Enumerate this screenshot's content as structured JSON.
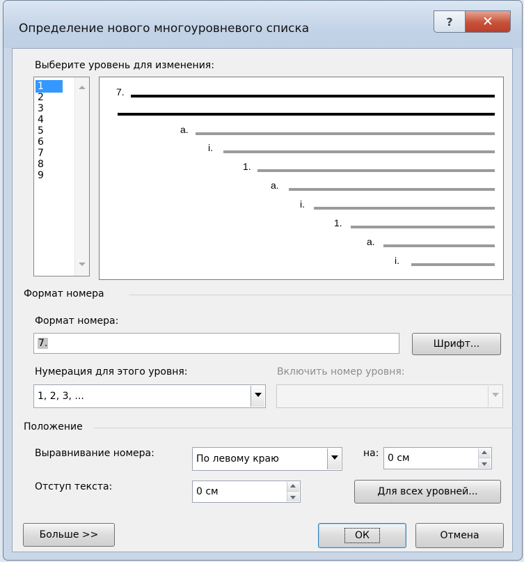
{
  "window": {
    "title": "Определение нового многоуровневого списка",
    "help_glyph": "?",
    "close_glyph": "✕"
  },
  "levels": {
    "label": "Выберите уровень для изменения:",
    "items": [
      "1",
      "2",
      "3",
      "4",
      "5",
      "6",
      "7",
      "8",
      "9"
    ],
    "selected": "1"
  },
  "preview": {
    "rows": [
      {
        "label": "7.",
        "bold": true
      },
      {
        "label": "",
        "bold": true
      },
      {
        "label": "a.",
        "bold": false
      },
      {
        "label": "i.",
        "bold": false
      },
      {
        "label": "1.",
        "bold": false
      },
      {
        "label": "a.",
        "bold": false
      },
      {
        "label": "i.",
        "bold": false
      },
      {
        "label": "1.",
        "bold": false
      },
      {
        "label": "a.",
        "bold": false
      },
      {
        "label": "i.",
        "bold": false
      }
    ]
  },
  "number_format": {
    "section_title": "Формат номера",
    "field_label": "Формат номера:",
    "value": "7.",
    "font_button": "Шрифт...",
    "numbering_label": "Нумерация для этого уровня:",
    "numbering_value": "1, 2, 3, ...",
    "include_label": "Включить номер уровня:",
    "include_value": ""
  },
  "position": {
    "section_title": "Положение",
    "alignment_label": "Выравнивание номера:",
    "alignment_value": "По левому краю",
    "at_label": "на:",
    "at_value": "0 см",
    "indent_label": "Отступ текста:",
    "indent_value": "0 см",
    "all_levels_button": "Для всех уровней..."
  },
  "footer": {
    "more_button": "Больше >>",
    "ok_button": "ОК",
    "cancel_button": "Отмена"
  },
  "colors": {
    "selection": "#3399ff",
    "close_button": "#c8513a",
    "preview_line": "#9b9b9b"
  }
}
